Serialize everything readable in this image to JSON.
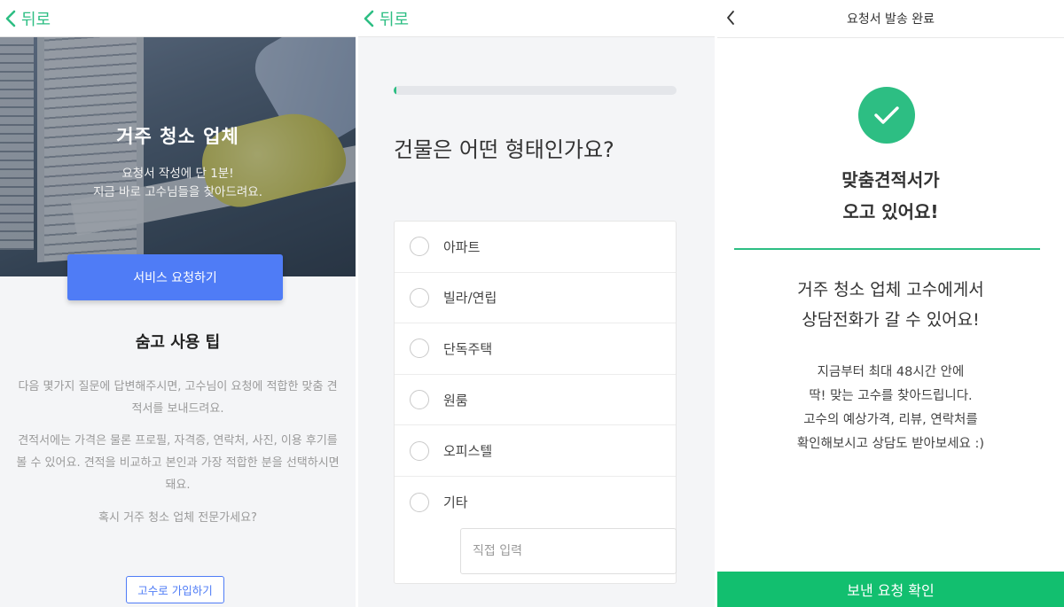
{
  "colors": {
    "accent_green": "#2dbe83",
    "cta_blue": "#4f7cf6",
    "confirm_green": "#12bf6f"
  },
  "screen1": {
    "back_label": "뒤로",
    "hero": {
      "title": "거주 청소 업체",
      "subtitle_line1": "요청서 작성에 단 1분!",
      "subtitle_line2": "지금 바로 고수님들을 찾아드려요."
    },
    "cta_label": "서비스 요청하기",
    "tips": {
      "title": "숨고 사용 팁",
      "para1": "다음 몇가지 질문에 답변해주시면, 고수님이 요청에 적합한 맞춤 견적서를 보내드려요.",
      "para2": "견적서에는 가격은 물론 프로필, 자격증, 연락처, 사진, 이용 후기를 볼 수 있어요. 견적을 비교하고 본인과 가장 적합한 분을 선택하시면 돼요.",
      "para3": "혹시 거주 청소 업체 전문가세요?"
    },
    "join_label": "고수로 가입하기"
  },
  "screen2": {
    "back_label": "뒤로",
    "progress_fraction": 0.01,
    "question": "건물은 어떤 형태인가요?",
    "options": [
      "아파트",
      "빌라/연립",
      "단독주택",
      "원룸",
      "오피스텔",
      "기타"
    ],
    "other_placeholder": "직접 입력"
  },
  "screen3": {
    "title": "요청서 발송 완료",
    "headline_line1": "맞춤견적서가",
    "headline_line2": "오고 있어요!",
    "sub_line1": "거주 청소 업체 고수에게서",
    "sub_line2": "상담전화가 갈 수 있어요!",
    "info_line1": "지금부터 최대 48시간 안에",
    "info_line2": "딱! 맞는 고수를 찾아드립니다.",
    "info_line3": "고수의 예상가격, 리뷰, 연락처를",
    "info_line4": "확인해보시고 상담도 받아보세요 :)",
    "confirm_label": "보낸 요청 확인"
  }
}
